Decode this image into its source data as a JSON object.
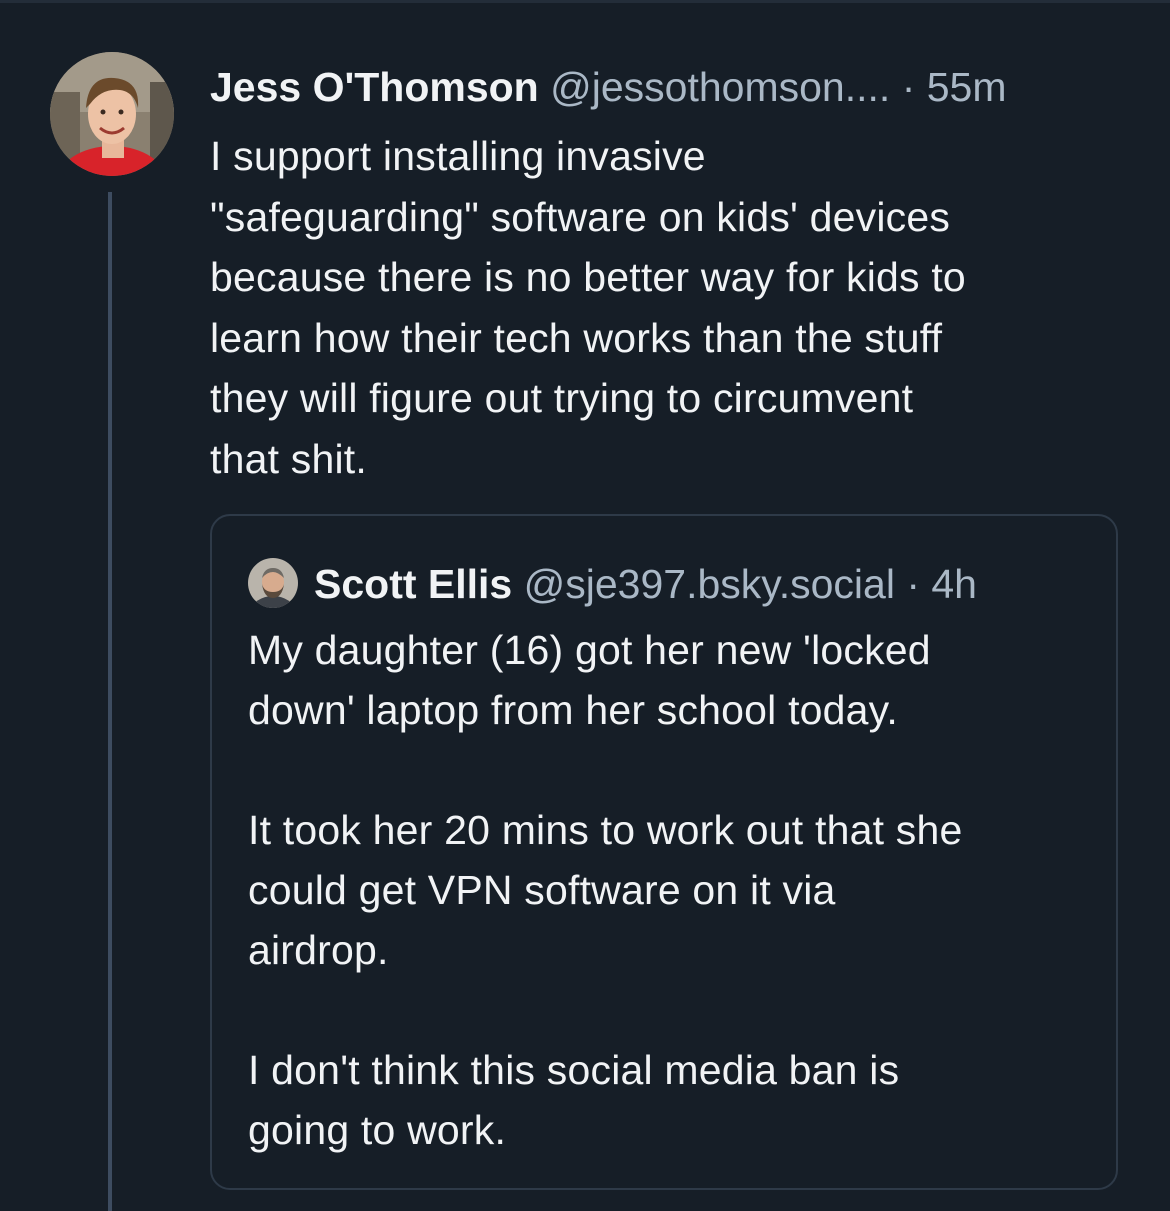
{
  "post": {
    "author_name": "Jess O'Thomson",
    "author_handle": "@jessothomson....",
    "separator": " · ",
    "time": "55m",
    "text": "I support installing invasive\n\"safeguarding\" software on kids' devices\nbecause there is no better way for kids to\nlearn how their tech works than the stuff\nthey will figure out trying to circumvent\nthat shit.",
    "avatar_icon": "person-avatar-icon"
  },
  "quote": {
    "author_name": "Scott Ellis",
    "author_handle": "@sje397.bsky.social",
    "separator": " · ",
    "time": "4h",
    "text": "My daughter (16) got her new 'locked\ndown' laptop from her school today.\n\nIt took her 20 mins to work out that she\ncould get VPN software on it via\nairdrop.\n\nI don't think this social media ban is\ngoing to work.",
    "avatar_icon": "person-avatar-icon"
  },
  "colors": {
    "background": "#161e27",
    "text": "#f1f3f5",
    "muted": "#aab8c6",
    "thread_line": "#3d4c60",
    "card_border": "#2e3a48"
  }
}
